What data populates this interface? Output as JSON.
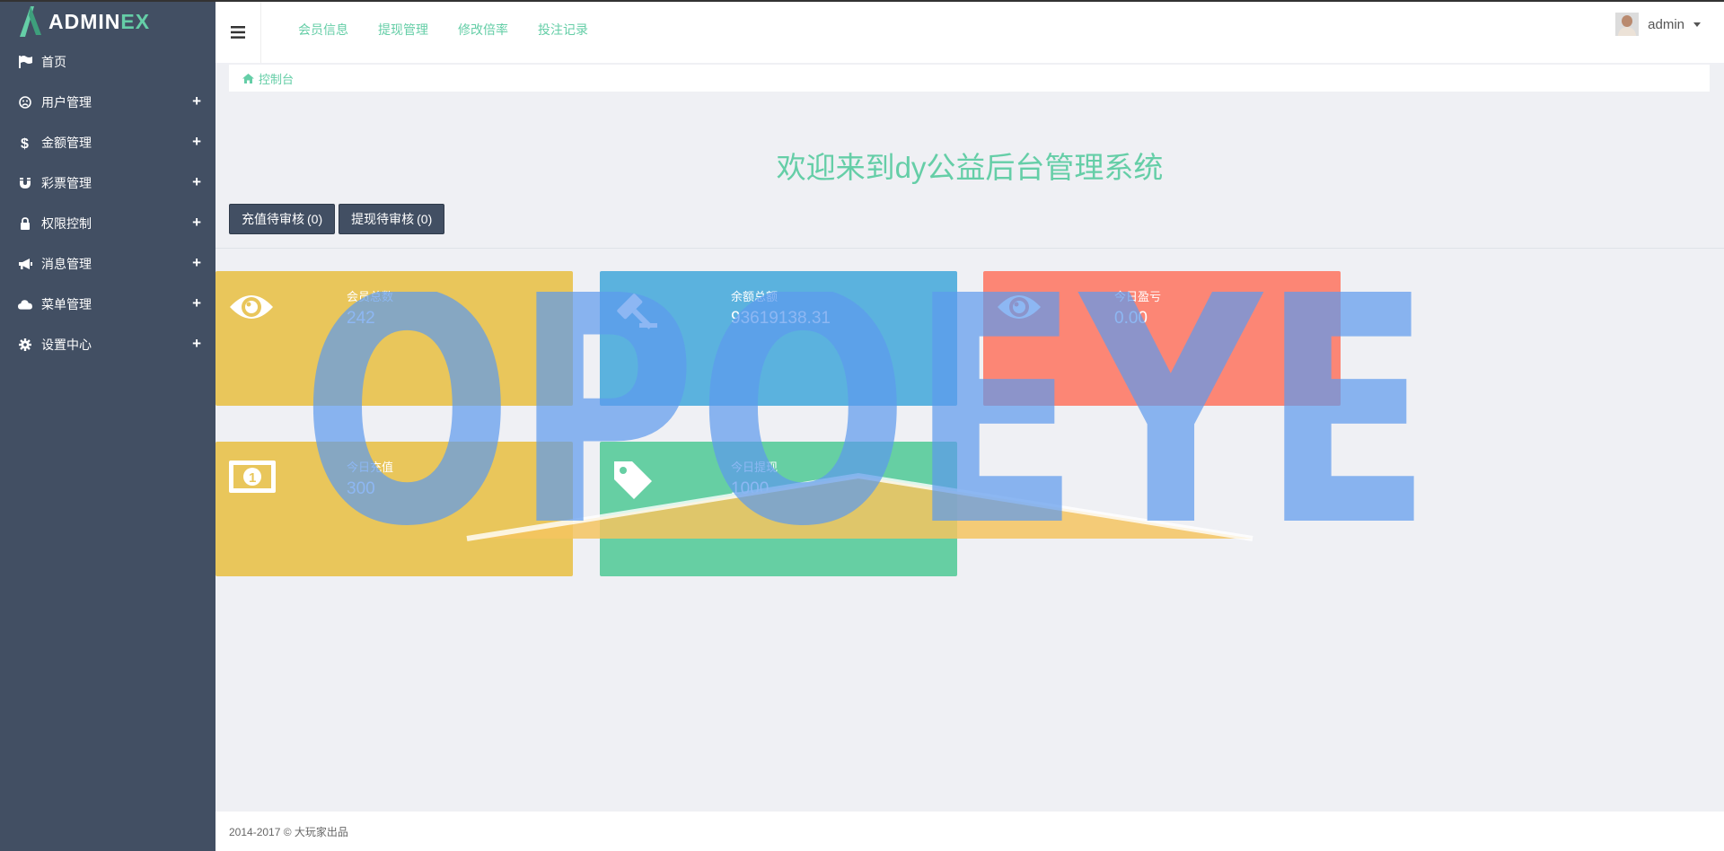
{
  "logo": {
    "text_main": "ADMIN",
    "text_accent": "EX"
  },
  "sidebar": {
    "items": [
      {
        "label": "首页",
        "icon": "flag-icon",
        "expandable": false
      },
      {
        "label": "用户管理",
        "icon": "frown-icon",
        "expandable": true
      },
      {
        "label": "金额管理",
        "icon": "dollar-icon",
        "expandable": true
      },
      {
        "label": "彩票管理",
        "icon": "magnet-icon",
        "expandable": true
      },
      {
        "label": "权限控制",
        "icon": "lock-icon",
        "expandable": true
      },
      {
        "label": "消息管理",
        "icon": "bullhorn-icon",
        "expandable": true
      },
      {
        "label": "菜单管理",
        "icon": "cloud-icon",
        "expandable": true
      },
      {
        "label": "设置中心",
        "icon": "gear-icon",
        "expandable": true
      }
    ],
    "plus": "+"
  },
  "topnav": [
    "会员信息",
    "提现管理",
    "修改倍率",
    "投注记录"
  ],
  "user": {
    "name": "admin"
  },
  "breadcrumb": {
    "label": "控制台"
  },
  "welcome": "欢迎来到dy公益后台管理系统",
  "pending": [
    {
      "label": "充值待审核",
      "count": "(0)"
    },
    {
      "label": "提现待审核",
      "count": "(0)"
    }
  ],
  "stats": [
    {
      "title": "会员总数",
      "value": "242",
      "icon": "eye-icon",
      "color": "#e9c65b"
    },
    {
      "title": "余额总额",
      "value": "93619138.31",
      "icon": "gavel-icon",
      "color": "#5bb2de"
    },
    {
      "title": "今日盈亏",
      "value": "0.00",
      "icon": "eye-icon",
      "color": "#fc8675"
    },
    {
      "title": "今日充值",
      "value": "300",
      "icon": "money-icon",
      "color": "#e9c65b"
    },
    {
      "title": "今日提现",
      "value": "1000",
      "icon": "tag-icon",
      "color": "#66cfa3"
    }
  ],
  "watermark": {
    "text": "OPOEYE"
  },
  "footer": "2014-2017 © 大玩家出品",
  "colors": {
    "sidebar": "#424f63",
    "accent": "#65cea7",
    "background": "#eff0f4"
  }
}
